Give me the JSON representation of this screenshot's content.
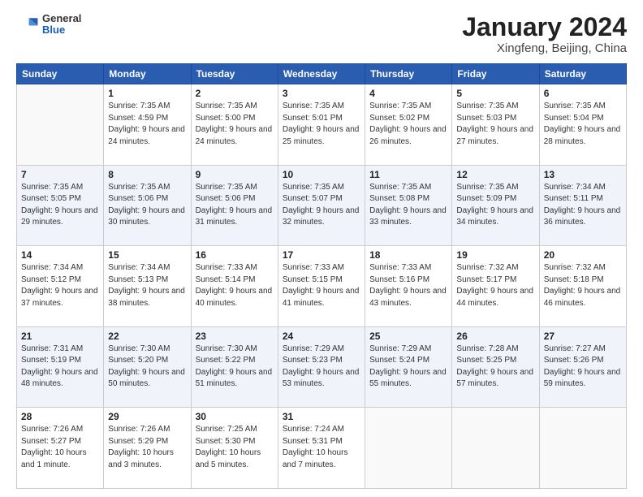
{
  "header": {
    "logo_general": "General",
    "logo_blue": "Blue",
    "month_title": "January 2024",
    "location": "Xingfeng, Beijing, China"
  },
  "days_of_week": [
    "Sunday",
    "Monday",
    "Tuesday",
    "Wednesday",
    "Thursday",
    "Friday",
    "Saturday"
  ],
  "weeks": [
    [
      {
        "day": "",
        "sunrise": "",
        "sunset": "",
        "daylight": ""
      },
      {
        "day": "1",
        "sunrise": "7:35 AM",
        "sunset": "4:59 PM",
        "daylight": "9 hours and 24 minutes."
      },
      {
        "day": "2",
        "sunrise": "7:35 AM",
        "sunset": "5:00 PM",
        "daylight": "9 hours and 24 minutes."
      },
      {
        "day": "3",
        "sunrise": "7:35 AM",
        "sunset": "5:01 PM",
        "daylight": "9 hours and 25 minutes."
      },
      {
        "day": "4",
        "sunrise": "7:35 AM",
        "sunset": "5:02 PM",
        "daylight": "9 hours and 26 minutes."
      },
      {
        "day": "5",
        "sunrise": "7:35 AM",
        "sunset": "5:03 PM",
        "daylight": "9 hours and 27 minutes."
      },
      {
        "day": "6",
        "sunrise": "7:35 AM",
        "sunset": "5:04 PM",
        "daylight": "9 hours and 28 minutes."
      }
    ],
    [
      {
        "day": "7",
        "sunrise": "7:35 AM",
        "sunset": "5:05 PM",
        "daylight": "9 hours and 29 minutes."
      },
      {
        "day": "8",
        "sunrise": "7:35 AM",
        "sunset": "5:06 PM",
        "daylight": "9 hours and 30 minutes."
      },
      {
        "day": "9",
        "sunrise": "7:35 AM",
        "sunset": "5:06 PM",
        "daylight": "9 hours and 31 minutes."
      },
      {
        "day": "10",
        "sunrise": "7:35 AM",
        "sunset": "5:07 PM",
        "daylight": "9 hours and 32 minutes."
      },
      {
        "day": "11",
        "sunrise": "7:35 AM",
        "sunset": "5:08 PM",
        "daylight": "9 hours and 33 minutes."
      },
      {
        "day": "12",
        "sunrise": "7:35 AM",
        "sunset": "5:09 PM",
        "daylight": "9 hours and 34 minutes."
      },
      {
        "day": "13",
        "sunrise": "7:34 AM",
        "sunset": "5:11 PM",
        "daylight": "9 hours and 36 minutes."
      }
    ],
    [
      {
        "day": "14",
        "sunrise": "7:34 AM",
        "sunset": "5:12 PM",
        "daylight": "9 hours and 37 minutes."
      },
      {
        "day": "15",
        "sunrise": "7:34 AM",
        "sunset": "5:13 PM",
        "daylight": "9 hours and 38 minutes."
      },
      {
        "day": "16",
        "sunrise": "7:33 AM",
        "sunset": "5:14 PM",
        "daylight": "9 hours and 40 minutes."
      },
      {
        "day": "17",
        "sunrise": "7:33 AM",
        "sunset": "5:15 PM",
        "daylight": "9 hours and 41 minutes."
      },
      {
        "day": "18",
        "sunrise": "7:33 AM",
        "sunset": "5:16 PM",
        "daylight": "9 hours and 43 minutes."
      },
      {
        "day": "19",
        "sunrise": "7:32 AM",
        "sunset": "5:17 PM",
        "daylight": "9 hours and 44 minutes."
      },
      {
        "day": "20",
        "sunrise": "7:32 AM",
        "sunset": "5:18 PM",
        "daylight": "9 hours and 46 minutes."
      }
    ],
    [
      {
        "day": "21",
        "sunrise": "7:31 AM",
        "sunset": "5:19 PM",
        "daylight": "9 hours and 48 minutes."
      },
      {
        "day": "22",
        "sunrise": "7:30 AM",
        "sunset": "5:20 PM",
        "daylight": "9 hours and 50 minutes."
      },
      {
        "day": "23",
        "sunrise": "7:30 AM",
        "sunset": "5:22 PM",
        "daylight": "9 hours and 51 minutes."
      },
      {
        "day": "24",
        "sunrise": "7:29 AM",
        "sunset": "5:23 PM",
        "daylight": "9 hours and 53 minutes."
      },
      {
        "day": "25",
        "sunrise": "7:29 AM",
        "sunset": "5:24 PM",
        "daylight": "9 hours and 55 minutes."
      },
      {
        "day": "26",
        "sunrise": "7:28 AM",
        "sunset": "5:25 PM",
        "daylight": "9 hours and 57 minutes."
      },
      {
        "day": "27",
        "sunrise": "7:27 AM",
        "sunset": "5:26 PM",
        "daylight": "9 hours and 59 minutes."
      }
    ],
    [
      {
        "day": "28",
        "sunrise": "7:26 AM",
        "sunset": "5:27 PM",
        "daylight": "10 hours and 1 minute."
      },
      {
        "day": "29",
        "sunrise": "7:26 AM",
        "sunset": "5:29 PM",
        "daylight": "10 hours and 3 minutes."
      },
      {
        "day": "30",
        "sunrise": "7:25 AM",
        "sunset": "5:30 PM",
        "daylight": "10 hours and 5 minutes."
      },
      {
        "day": "31",
        "sunrise": "7:24 AM",
        "sunset": "5:31 PM",
        "daylight": "10 hours and 7 minutes."
      },
      {
        "day": "",
        "sunrise": "",
        "sunset": "",
        "daylight": ""
      },
      {
        "day": "",
        "sunrise": "",
        "sunset": "",
        "daylight": ""
      },
      {
        "day": "",
        "sunrise": "",
        "sunset": "",
        "daylight": ""
      }
    ]
  ]
}
